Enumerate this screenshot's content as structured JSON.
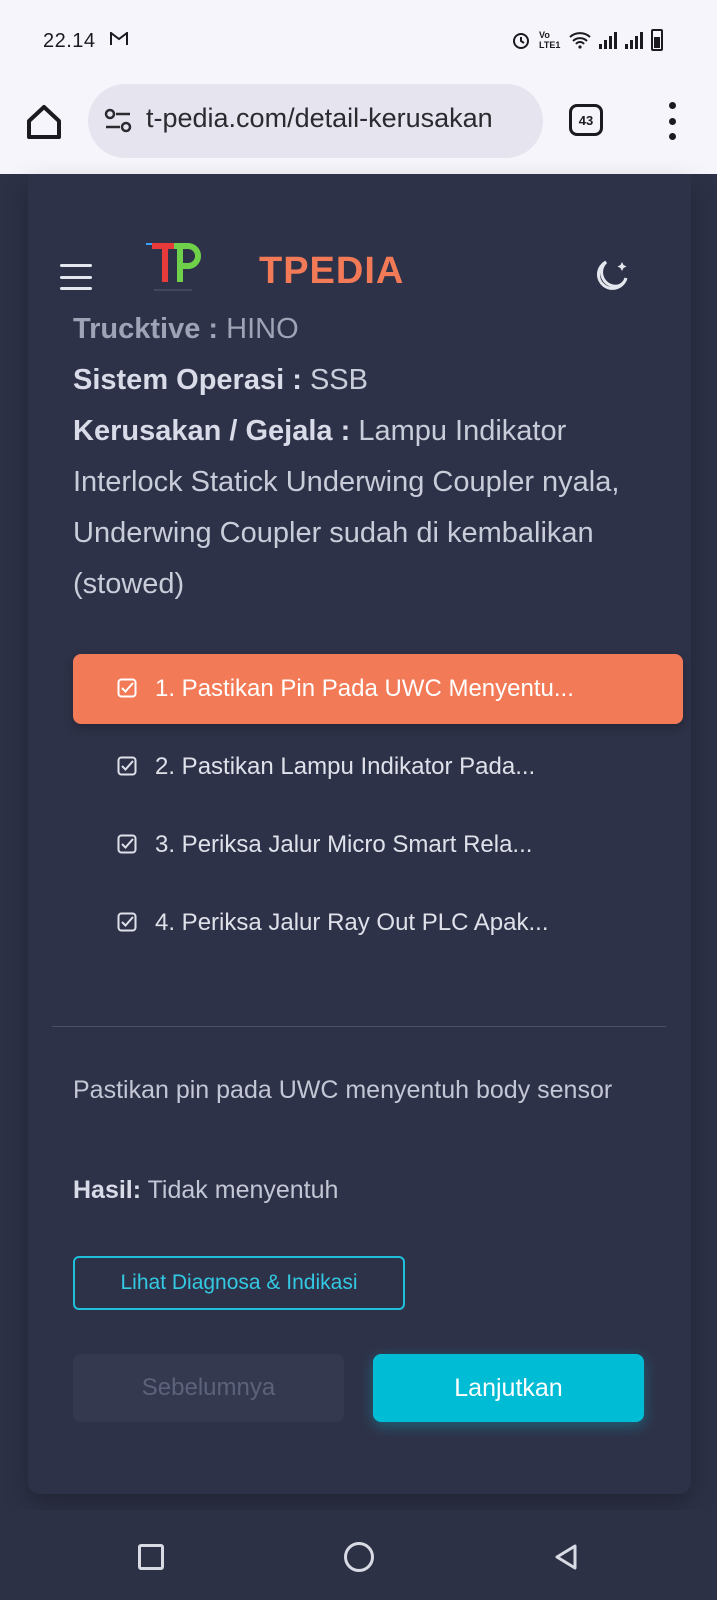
{
  "status_bar": {
    "time": "22.14",
    "mail_icon": "gmail-icon",
    "alarm_icon": "alarm-icon",
    "volte_label": "Vo LTE1",
    "wifi_icon": "wifi-icon"
  },
  "browser": {
    "url": "t-pedia.com/detail-kerusakan",
    "tab_count": "43"
  },
  "header": {
    "brand": "TPEDIA"
  },
  "details": {
    "trucktive_label": "Trucktive :",
    "trucktive_value": "HINO",
    "sistem_label": "Sistem Operasi :",
    "sistem_value": "SSB",
    "kerusakan_label": "Kerusakan / Gejala :",
    "kerusakan_value": "Lampu Indikator Interlock Statick Underwing Coupler nyala, Underwing Coupler sudah di kembalikan (stowed)"
  },
  "steps": [
    {
      "label": "1. Pastikan Pin Pada UWC Menyentu...",
      "active": true
    },
    {
      "label": "2. Pastikan Lampu Indikator Pada...",
      "active": false
    },
    {
      "label": "3. Periksa Jalur Micro Smart Rela...",
      "active": false
    },
    {
      "label": "4. Periksa Jalur Ray Out PLC Apak...",
      "active": false
    }
  ],
  "current_step": {
    "description": "Pastikan pin pada UWC menyentuh body sensor",
    "result_label": "Hasil:",
    "result_value": "Tidak menyentuh"
  },
  "buttons": {
    "diagnosa": "Lihat Diagnosa & Indikasi",
    "previous": "Sebelumnya",
    "next": "Lanjutkan"
  },
  "colors": {
    "accent": "#f37a57",
    "primary": "#00bcd4",
    "background": "#2c3146"
  }
}
